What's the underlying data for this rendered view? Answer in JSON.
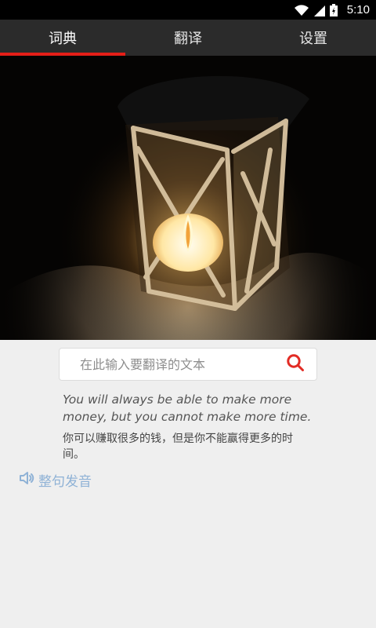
{
  "status_bar": {
    "time": "5:10",
    "icons": [
      "wifi-icon",
      "signal-icon",
      "battery-icon"
    ]
  },
  "tabs": [
    {
      "label": "词典",
      "active": true
    },
    {
      "label": "翻译",
      "active": false
    },
    {
      "label": "设置",
      "active": false
    }
  ],
  "hero": {
    "description_icon": "lantern-image"
  },
  "search": {
    "placeholder": "在此输入要翻译的文本",
    "icon": "search-icon"
  },
  "quote": {
    "english": "You will always be able to make more money, but you cannot make more time.",
    "chinese": "你可以赚取很多的钱，但是你不能赢得更多的时间。"
  },
  "speak": {
    "label": "整句发音",
    "icon": "speaker-icon"
  },
  "colors": {
    "accent": "#e41f18",
    "tabbar_bg": "#2b2b2b",
    "link_blue": "#8fb2d6"
  }
}
